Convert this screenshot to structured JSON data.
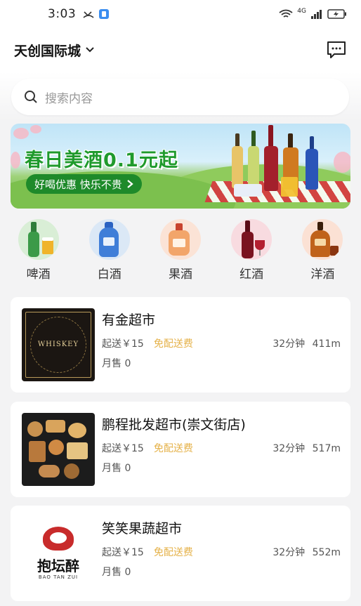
{
  "status": {
    "time": "3:03",
    "network": "4G"
  },
  "header": {
    "location": "天创国际城"
  },
  "search": {
    "placeholder": "搜索内容"
  },
  "banner": {
    "title": "春日美酒0.1元起",
    "subtitle": "好喝优惠 快乐不贵"
  },
  "categories": [
    {
      "label": "啤酒",
      "icon": "beer-icon"
    },
    {
      "label": "白酒",
      "icon": "baijiu-icon"
    },
    {
      "label": "果酒",
      "icon": "fruit-wine-icon"
    },
    {
      "label": "红酒",
      "icon": "red-wine-icon"
    },
    {
      "label": "洋酒",
      "icon": "liquor-icon"
    }
  ],
  "shops": [
    {
      "name": "有金超市",
      "min_order": "起送￥15",
      "delivery": "免配送费",
      "time": "32分钟",
      "distance": "411m",
      "sales": "月售 0",
      "thumb_text": "WHISKEY"
    },
    {
      "name": "鹏程批发超市(崇文街店)",
      "min_order": "起送￥15",
      "delivery": "免配送费",
      "time": "32分钟",
      "distance": "517m",
      "sales": "月售 0"
    },
    {
      "name": "笑笑果蔬超市",
      "min_order": "起送￥15",
      "delivery": "免配送费",
      "time": "32分钟",
      "distance": "552m",
      "sales": "月售 0",
      "thumb_text": "抱坛醉",
      "thumb_sub": "BAO TAN ZUI"
    }
  ],
  "colors": {
    "accent_green": "#1f9a2c",
    "free_delivery": "#e5b24a"
  }
}
